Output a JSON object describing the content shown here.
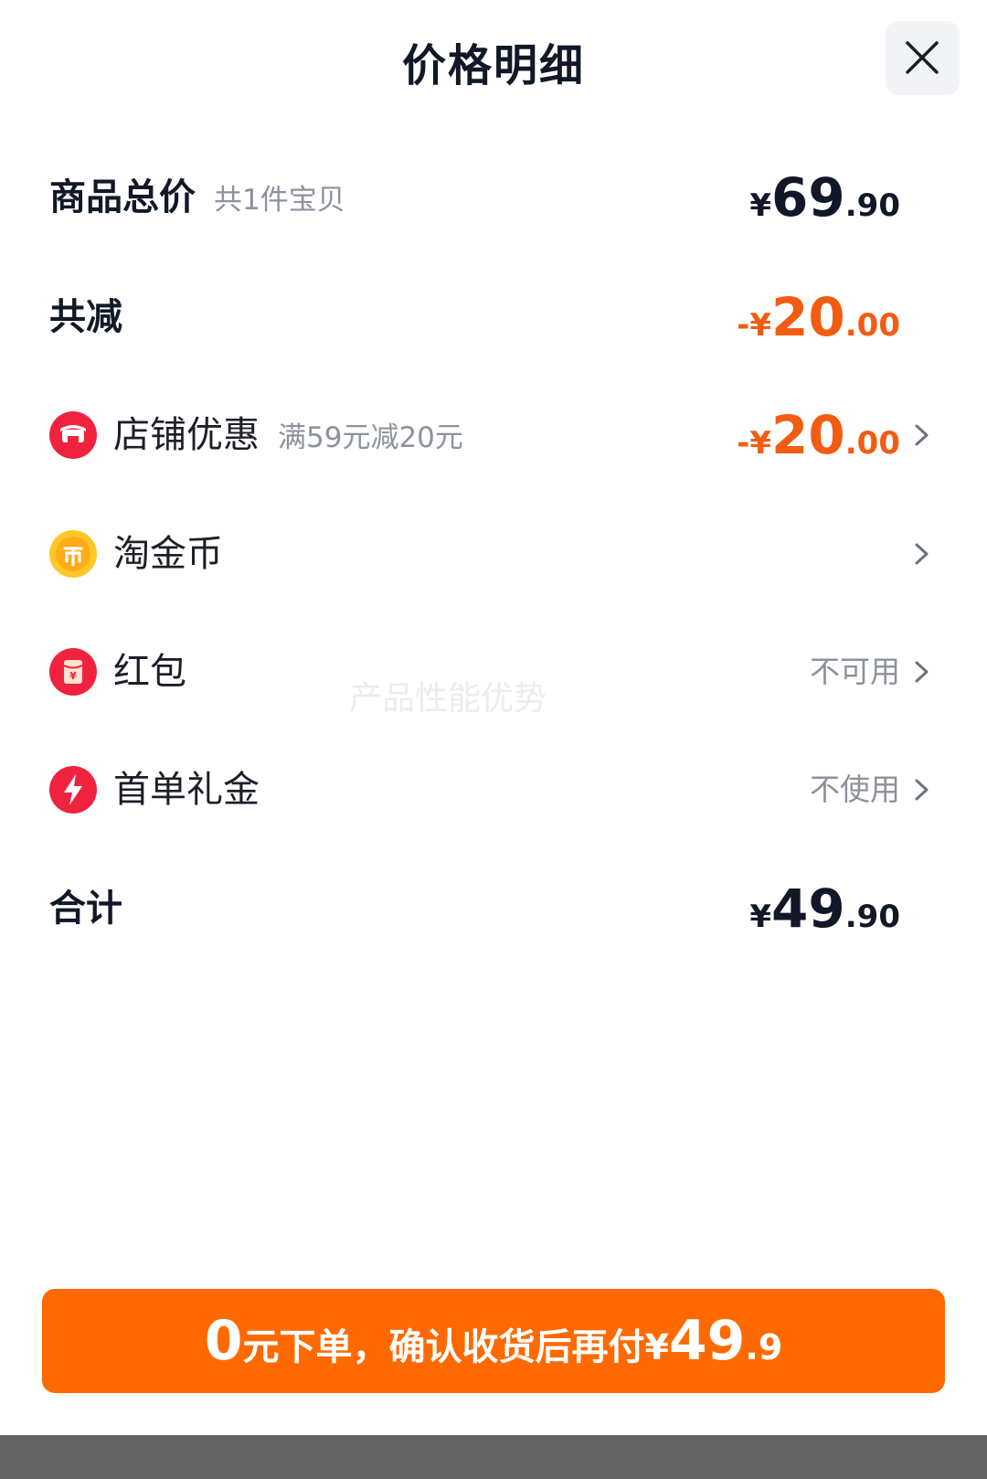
{
  "header": {
    "title": "价格明细",
    "close_icon": "close-icon"
  },
  "rows": {
    "total_goods": {
      "label": "商品总价",
      "sub": "共1件宝贝",
      "currency": "¥",
      "int": "69",
      "dec": ".90"
    },
    "total_discount": {
      "label": "共减",
      "prefix": "-¥",
      "int": "20",
      "dec": ".00"
    },
    "shop_discount": {
      "icon": "store-icon",
      "label": "店铺优惠",
      "sub": "满59元减20元",
      "prefix": "-¥",
      "int": "20",
      "dec": ".00"
    },
    "gold_coins": {
      "icon": "coin-icon",
      "label": "淘金币"
    },
    "red_packet": {
      "icon": "red-packet-icon",
      "label": "红包",
      "status": "不可用"
    },
    "first_order_gift": {
      "icon": "lightning-icon",
      "label": "首单礼金",
      "status": "不使用"
    },
    "sum": {
      "label": "合计",
      "currency": "¥",
      "int": "49",
      "dec": ".90"
    }
  },
  "watermark": "产品性能优势",
  "cta": {
    "big": "0",
    "text": "元下单，确认收货后再付",
    "currency": "¥",
    "int": "49",
    "dec": ".9"
  },
  "colors": {
    "accent_orange": "#ff6a00",
    "discount_orange": "#f25c12",
    "text_dark": "#111827",
    "text_muted": "#8c929c"
  }
}
